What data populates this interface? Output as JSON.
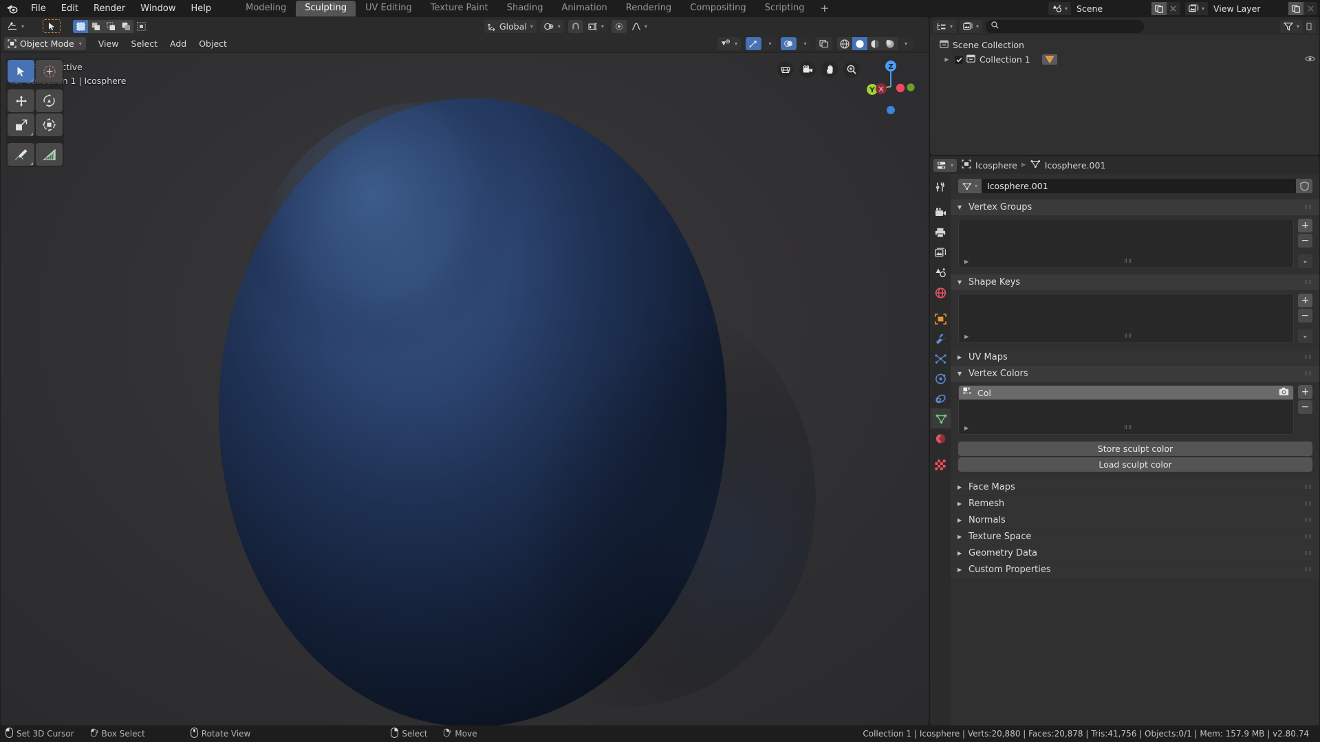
{
  "app": {
    "title": "Blender",
    "version": "v2.80.74"
  },
  "topbar": {
    "logo_icon": "blender-logo-icon",
    "menus": [
      "File",
      "Edit",
      "Render",
      "Window",
      "Help"
    ],
    "workspace_tabs": [
      {
        "label": "Modeling",
        "active": false
      },
      {
        "label": "Sculpting",
        "active": true
      },
      {
        "label": "UV Editing",
        "active": false
      },
      {
        "label": "Texture Paint",
        "active": false
      },
      {
        "label": "Shading",
        "active": false
      },
      {
        "label": "Animation",
        "active": false
      },
      {
        "label": "Rendering",
        "active": false
      },
      {
        "label": "Compositing",
        "active": false
      },
      {
        "label": "Scripting",
        "active": false
      }
    ],
    "add_workspace_label": "+",
    "scene": {
      "icon": "scene-icon",
      "name": "Scene",
      "copy_icon": "duplicate-icon",
      "close_icon": "x-icon"
    },
    "view_layer": {
      "icon": "view-layer-icon",
      "name": "View Layer",
      "copy_icon": "duplicate-icon",
      "close_icon": "x-icon"
    }
  },
  "viewport": {
    "header": {
      "editor_type_icon": "editor-type-3dview-icon",
      "select_mode_icons": [
        "tweak-select-icon",
        "box-select-icon",
        "circle-select-icon",
        "lasso-select-icon",
        "select-extend-icon"
      ],
      "mode": "Object Mode",
      "menus": [
        "View",
        "Select",
        "Add",
        "Object"
      ],
      "transform_orientation": "Global",
      "snap_icon": "magnet-icon",
      "snap_target_icon": "snap-increment-icon",
      "proportional_icon": "proportional-edit-icon",
      "falloff_icon": "smooth-falloff-icon",
      "visibility_icon": "object-types-visibility-icon",
      "gizmo_icon": "gizmo-icon",
      "overlays_icon": "overlays-icon",
      "xray_icon": "toggle-xray-icon",
      "shading_icons": [
        "shading-wireframe-icon",
        "shading-solid-icon",
        "shading-material-icon",
        "shading-rendered-icon"
      ]
    },
    "overlay_text_line1": "User Perspective",
    "overlay_text_line2": "(1) Collection 1 | Icosphere",
    "toolbar_tools": [
      {
        "name": "tweak-tool",
        "active": true
      },
      {
        "name": "select-circle-tool",
        "active": false
      },
      {
        "name": "move-tool",
        "active": false
      },
      {
        "name": "rotate-tool",
        "active": false
      },
      {
        "name": "scale-tool",
        "active": false
      },
      {
        "name": "transform-tool",
        "active": false
      },
      {
        "name": "annotate-tool",
        "active": false
      },
      {
        "name": "measure-tool",
        "active": false
      }
    ],
    "nav_buttons": [
      "toggle-perspective-icon",
      "camera-view-icon",
      "move-view-icon",
      "zoom-view-icon"
    ],
    "gizmo_axes": [
      {
        "label": "Z",
        "color": "#4b9cf5"
      },
      {
        "label": "Y",
        "color": "#9ed13a"
      },
      {
        "label": "X",
        "color": "#f04f5c"
      }
    ],
    "object_color_light": "#2a4063",
    "object_color_dark": "#0c1219"
  },
  "outliner": {
    "display_mode_icon": "outliner-display-mode-icon",
    "filter_id_icon": "view-layer-icon",
    "search_placeholder": "",
    "search_value": "",
    "search_icon": "search-icon",
    "filter_icon": "filter-icon",
    "rows": [
      {
        "indent": 0,
        "icon": "collection-icon",
        "label": "Scene Collection",
        "has_disclosure": false,
        "has_checkbox": false,
        "badge": null,
        "eye": false
      },
      {
        "indent": 1,
        "icon": "collection-icon",
        "label": "Collection 1",
        "has_disclosure": true,
        "has_checkbox": true,
        "badge": "mesh-data-icon",
        "eye": true
      }
    ]
  },
  "properties": {
    "editor_icon": "properties-editor-icon",
    "breadcrumb": [
      {
        "icon": "object-icon",
        "label": "Icosphere"
      },
      {
        "icon": "mesh-data-icon",
        "label": "Icosphere.001"
      }
    ],
    "id_field": {
      "icon": "mesh-data-icon",
      "value": "Icosphere.001",
      "shield_icon": "fake-user-shield-icon"
    },
    "tabs": [
      {
        "name": "tool-tab",
        "icon": "tool-icon",
        "selected": false
      },
      {
        "name": "render-tab",
        "icon": "render-camera-icon",
        "selected": false
      },
      {
        "name": "output-tab",
        "icon": "output-printer-icon",
        "selected": false
      },
      {
        "name": "view-layer-tab",
        "icon": "view-layer-images-icon",
        "selected": false
      },
      {
        "name": "scene-tab",
        "icon": "scene-cone-icon",
        "selected": false
      },
      {
        "name": "world-tab",
        "icon": "world-globe-icon",
        "selected": false
      },
      {
        "name": "object-tab",
        "icon": "object-square-icon",
        "selected": false
      },
      {
        "name": "modifiers-tab",
        "icon": "wrench-icon",
        "selected": false
      },
      {
        "name": "particles-tab",
        "icon": "particles-icon",
        "selected": false
      },
      {
        "name": "physics-tab",
        "icon": "physics-orbit-icon",
        "selected": false
      },
      {
        "name": "constraints-tab",
        "icon": "constraints-icon",
        "selected": false
      },
      {
        "name": "data-tab",
        "icon": "mesh-data-triangle-icon",
        "selected": true
      },
      {
        "name": "material-tab",
        "icon": "material-sphere-icon",
        "selected": false
      },
      {
        "name": "texture-tab",
        "icon": "texture-checker-icon",
        "selected": false
      }
    ],
    "panels": [
      {
        "label": "Vertex Groups",
        "open": true,
        "type": "uilist",
        "items": [],
        "buttons": [
          "add",
          "remove",
          "chevron"
        ]
      },
      {
        "label": "Shape Keys",
        "open": true,
        "type": "uilist",
        "items": [],
        "buttons": [
          "add",
          "remove",
          "chevron"
        ]
      },
      {
        "label": "UV Maps",
        "open": false,
        "type": "closed"
      },
      {
        "label": "Vertex Colors",
        "open": true,
        "type": "uilist",
        "items": [
          {
            "icon": "vertex-color-icon",
            "label": "Col",
            "selected": true,
            "render_icon": "camera-render-icon"
          }
        ],
        "buttons": [
          "add",
          "remove"
        ]
      },
      {
        "label": "Face Maps",
        "open": false,
        "type": "closed"
      },
      {
        "label": "Remesh",
        "open": false,
        "type": "closed"
      },
      {
        "label": "Normals",
        "open": false,
        "type": "closed"
      },
      {
        "label": "Texture Space",
        "open": false,
        "type": "closed"
      },
      {
        "label": "Geometry Data",
        "open": false,
        "type": "closed"
      },
      {
        "label": "Custom Properties",
        "open": false,
        "type": "closed"
      }
    ],
    "store_sculpt_color_label": "Store sculpt color",
    "load_sculpt_color_label": "Load sculpt color"
  },
  "statusbar": {
    "keymap": [
      {
        "icon": "mouse-left-icon",
        "label": "Set 3D Cursor"
      },
      {
        "icon": "mouse-left-drag-icon",
        "label": "Box Select"
      },
      {
        "icon": "mouse-middle-icon",
        "label": "Rotate View"
      },
      {
        "icon": "mouse-right-icon",
        "label": "Select"
      },
      {
        "icon": "mouse-right-drag-icon",
        "label": "Move"
      }
    ],
    "stats": "Collection 1 | Icosphere | Verts:20,880 | Faces:20,878 | Tris:41,756 | Objects:0/1 | Mem: 157.9 MB | v2.80.74"
  }
}
